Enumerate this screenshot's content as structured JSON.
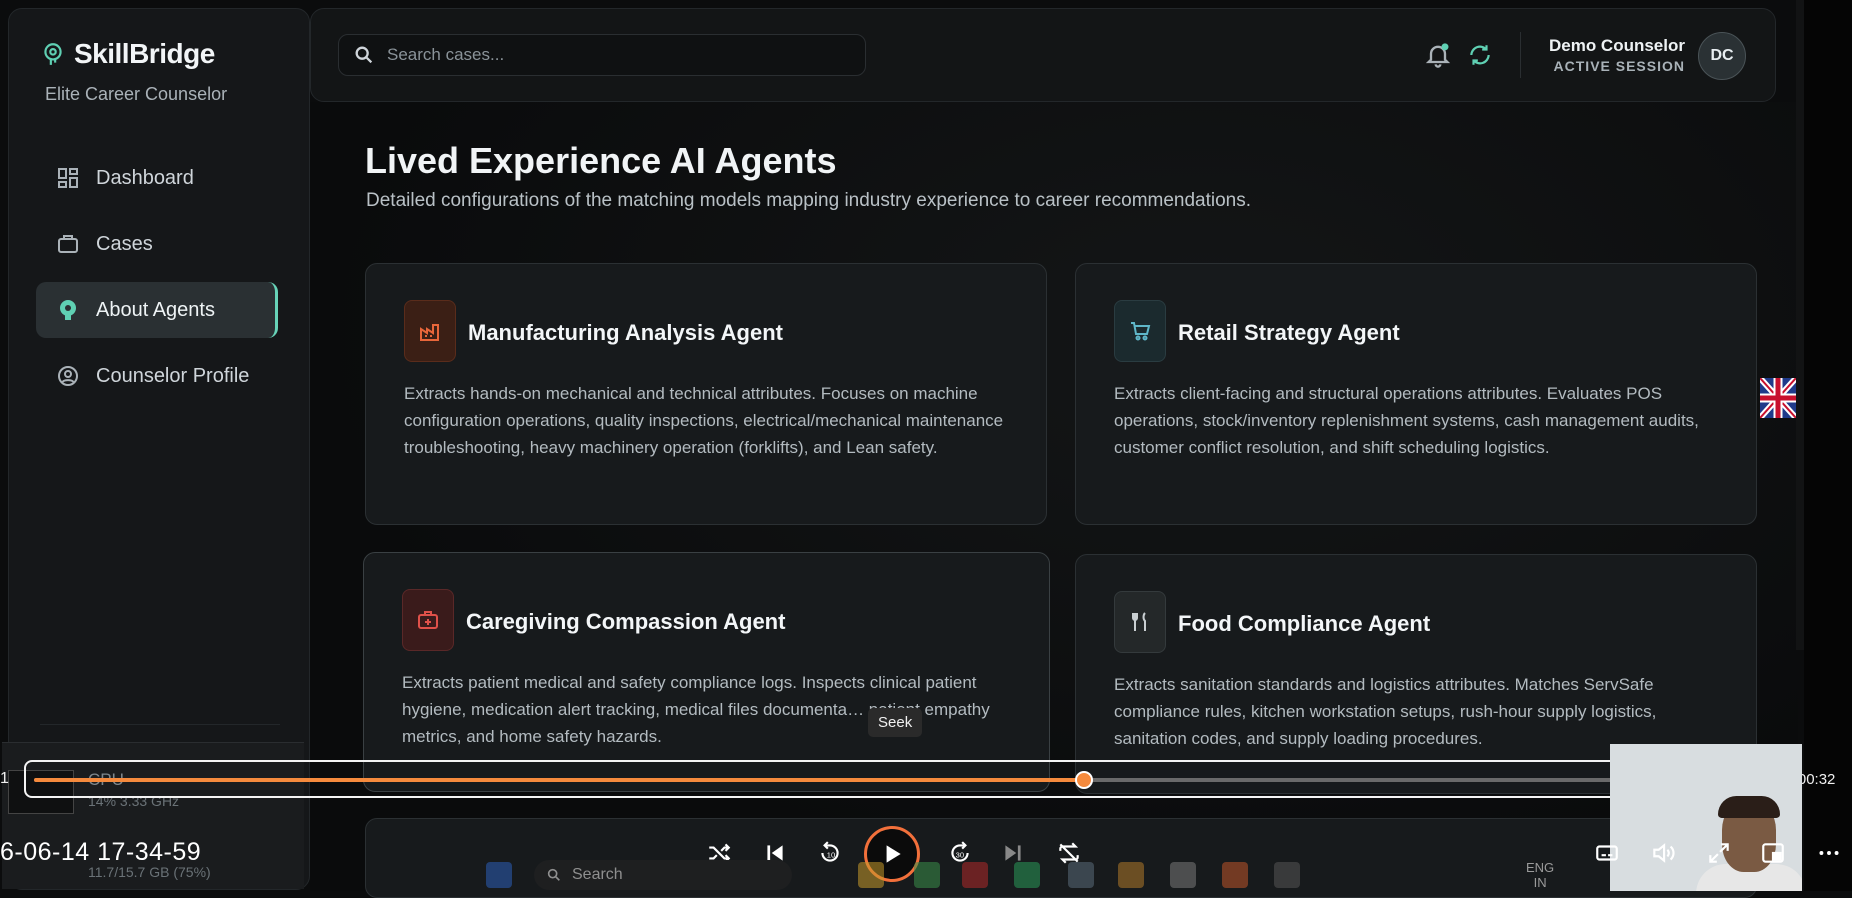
{
  "sidebar": {
    "brand": "SkillBridge",
    "subtitle": "Elite Career Counselor",
    "items": [
      {
        "label": "Dashboard",
        "icon": "dashboard-icon"
      },
      {
        "label": "Cases",
        "icon": "briefcase-icon"
      },
      {
        "label": "About Agents",
        "icon": "brain-icon",
        "active": true
      },
      {
        "label": "Counselor Profile",
        "icon": "user-circle-icon"
      }
    ],
    "system": {
      "cpu_label": "CPU",
      "cpu_value": "14% 3.33 GHz",
      "memory_value": "11.7/15.7 GB (75%)"
    }
  },
  "header": {
    "search_placeholder": "Search cases...",
    "user_name": "Demo Counselor",
    "user_status": "ACTIVE SESSION",
    "avatar_initials": "DC"
  },
  "main": {
    "title": "Lived Experience AI Agents",
    "description": "Detailed configurations of the matching models mapping industry experience to career recommendations.",
    "agents": [
      {
        "title": "Manufacturing Analysis Agent",
        "icon": "factory-icon",
        "accent": "#e8663a",
        "description": "Extracts hands-on mechanical and technical attributes. Focuses on machine configuration operations, quality inspections, electrical/mechanical maintenance troubleshooting, heavy machinery operation (forklifts), and Lean safety."
      },
      {
        "title": "Retail Strategy Agent",
        "icon": "cart-icon",
        "accent": "#5fb7c9",
        "description": "Extracts client-facing and structural operations attributes. Evaluates POS operations, stock/inventory replenishment systems, cash management audits, customer conflict resolution, and shift scheduling logistics."
      },
      {
        "title": "Caregiving Compassion Agent",
        "icon": "medical-kit-icon",
        "accent": "#e0514a",
        "description": "Extracts patient medical and safety compliance logs. Inspects clinical patient hygiene, medication alert tracking, medical files documenta… patient empathy metrics, and home safety hazards."
      },
      {
        "title": "Food Compliance Agent",
        "icon": "utensils-icon",
        "accent": "#c9cfd2",
        "description": "Extracts sanitation standards and logistics attributes. Matches ServSafe compliance rules, kitchen workstation setups, rush-hour supply logistics, sanitation codes, and supply loading procedures."
      }
    ]
  },
  "player": {
    "tooltip": "Seek",
    "time_left": "1",
    "time_right": "00:00:32",
    "progress": 0.61,
    "timestamp": "6-06-14 17-34-59",
    "accent": "#f58a3d"
  },
  "taskbar": {
    "search_label": "Search",
    "language": "ENG",
    "region": "IN"
  }
}
